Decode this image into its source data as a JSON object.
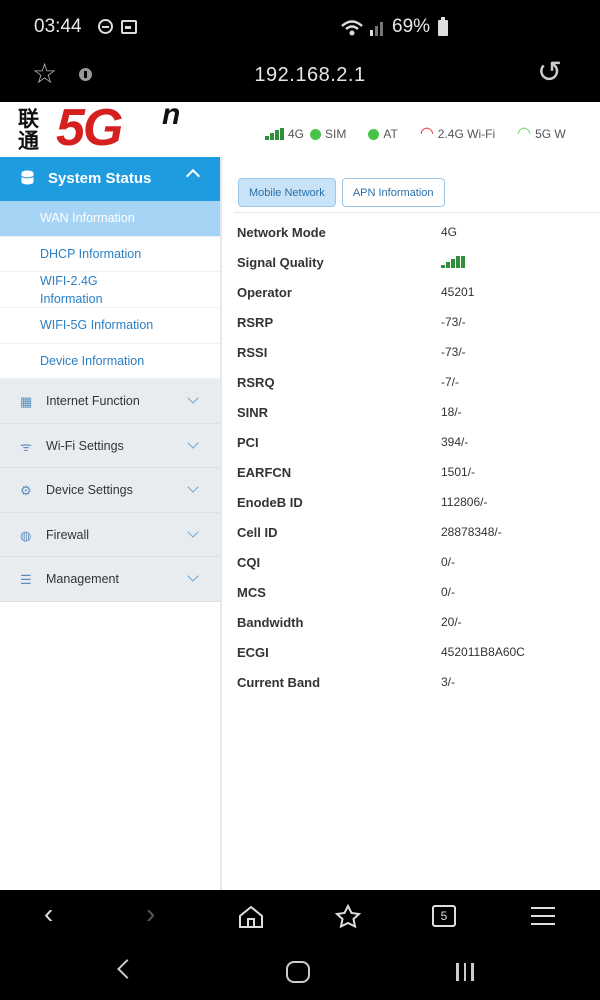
{
  "status_bar": {
    "time": "03:44",
    "battery": "69%"
  },
  "browser": {
    "url": "192.168.2.1"
  },
  "header": {
    "logo_cn": "联通",
    "logo_5g": "5G",
    "logo_sup": "n",
    "indicators": {
      "net": "4G",
      "sim": "SIM",
      "at": "AT",
      "wifi24": "2.4G Wi-Fi",
      "wifi5": "5G W"
    }
  },
  "sidebar": {
    "section_title": "System Status",
    "sub_items": [
      {
        "label": "WAN Information"
      },
      {
        "label": "DHCP Information"
      },
      {
        "label": "WIFI-2.4G Information"
      },
      {
        "label": "WIFI-5G Information"
      },
      {
        "label": "Device Information"
      }
    ],
    "groups": [
      {
        "label": "Internet Function",
        "icon": "grid-icon"
      },
      {
        "label": "Wi-Fi Settings",
        "icon": "wifi-icon"
      },
      {
        "label": "Device Settings",
        "icon": "gear-icon"
      },
      {
        "label": "Firewall",
        "icon": "globe-icon"
      },
      {
        "label": "Management",
        "icon": "sliders-icon"
      }
    ]
  },
  "main": {
    "tabs": [
      {
        "label": "Mobile Network"
      },
      {
        "label": "APN Information"
      }
    ],
    "rows": [
      {
        "key": "Network Mode",
        "value": "4G"
      },
      {
        "key": "Signal Quality",
        "value": ""
      },
      {
        "key": "Operator",
        "value": "45201"
      },
      {
        "key": "RSRP",
        "value": "-73/-"
      },
      {
        "key": "RSSI",
        "value": "-73/-"
      },
      {
        "key": "RSRQ",
        "value": "-7/-"
      },
      {
        "key": "SINR",
        "value": "18/-"
      },
      {
        "key": "PCI",
        "value": "394/-"
      },
      {
        "key": "EARFCN",
        "value": "1501/-"
      },
      {
        "key": "EnodeB ID",
        "value": "112806/-"
      },
      {
        "key": "Cell ID",
        "value": "28878348/-"
      },
      {
        "key": "CQI",
        "value": "0/-"
      },
      {
        "key": "MCS",
        "value": "0/-"
      },
      {
        "key": "Bandwidth",
        "value": "20/-"
      },
      {
        "key": "ECGI",
        "value": "452011B8A60C"
      },
      {
        "key": "Current Band",
        "value": "3/-"
      }
    ]
  },
  "bottom_bar": {
    "tab_count": "5"
  },
  "colors": {
    "accent": "#1f9be0",
    "active_item": "#a5d4f5",
    "brand_red": "#d61f1f",
    "signal_green": "#2f8f3a"
  }
}
